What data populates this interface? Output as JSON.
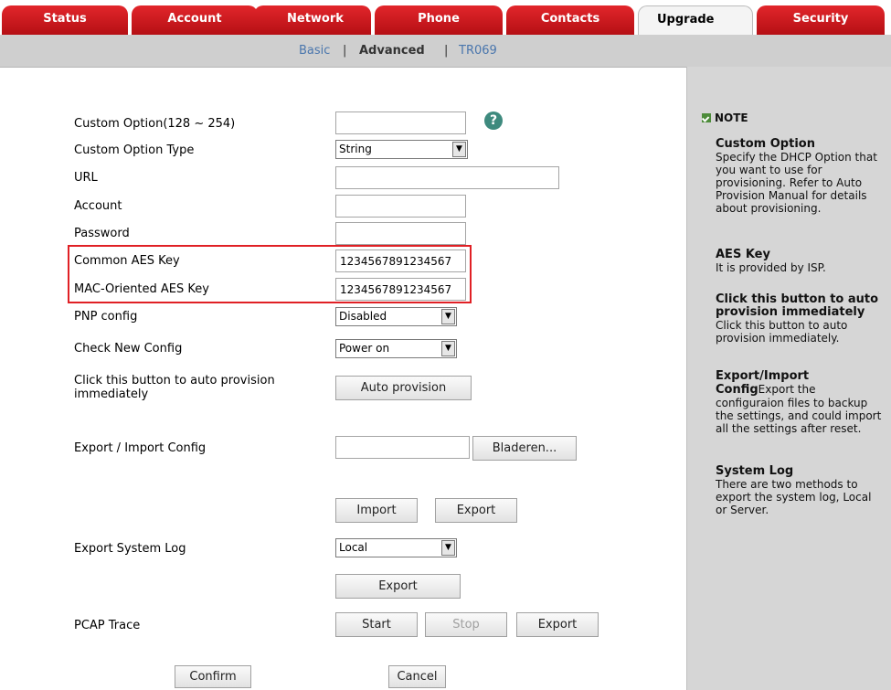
{
  "tabs": [
    {
      "label": "Status"
    },
    {
      "label": "Account"
    },
    {
      "label": "Network"
    },
    {
      "label": "Phone"
    },
    {
      "label": "Contacts"
    },
    {
      "label": "Upgrade",
      "active": true
    },
    {
      "label": "Security"
    }
  ],
  "subnav": {
    "basic": "Basic",
    "advanced": "Advanced",
    "tr069": "TR069",
    "separator": "|"
  },
  "form": {
    "custom_option": {
      "label": "Custom Option(128 ~ 254)",
      "value": ""
    },
    "custom_option_type": {
      "label": "Custom Option Type",
      "value": "String"
    },
    "url": {
      "label": "URL",
      "value": ""
    },
    "account": {
      "label": "Account",
      "value": ""
    },
    "password": {
      "label": "Password",
      "value": ""
    },
    "common_aes_key": {
      "label": "Common AES Key",
      "value": "1234567891234567"
    },
    "mac_aes_key": {
      "label": "MAC-Oriented AES Key",
      "value": "1234567891234567"
    },
    "pnp_config": {
      "label": "PNP config",
      "value": "Disabled"
    },
    "check_new_config": {
      "label": "Check New Config",
      "value": "Power on"
    },
    "auto_provision": {
      "label": "Click this button to auto provision immediately",
      "button": "Auto provision"
    },
    "export_import": {
      "label": "Export / Import Config",
      "value": "",
      "browse": "Bladeren...",
      "import": "Import",
      "export": "Export"
    },
    "system_log": {
      "label": "Export System Log",
      "value": "Local",
      "export": "Export"
    },
    "pcap": {
      "label": "PCAP Trace",
      "start": "Start",
      "stop": "Stop",
      "export": "Export"
    },
    "confirm": "Confirm",
    "cancel": "Cancel",
    "help_glyph": "?"
  },
  "note": {
    "title": "NOTE",
    "sections": [
      {
        "title": "Custom Option",
        "lines": [
          "Specify the DHCP Option that",
          "you want to use for",
          "provisioning. Refer to Auto",
          "Provision Manual for details",
          "about provisioning."
        ]
      },
      {
        "title": "AES Key",
        "lines": [
          "It is provided by ISP."
        ]
      },
      {
        "title_lines": [
          "Click this button to auto",
          "provision immediately"
        ],
        "lines": [
          "Click this button to auto",
          "provision immediately."
        ]
      },
      {
        "title_lines": [
          "Export/Import"
        ],
        "inline_bold": "Config",
        "inline_rest": "Export the",
        "lines": [
          "configuraion files to backup",
          "the settings, and could import",
          "all the settings after reset."
        ]
      },
      {
        "title": "System Log",
        "lines": [
          "There are two methods to",
          "export the system log, Local",
          "or Server."
        ]
      }
    ]
  },
  "colors": {
    "tab_red": "#d11a20",
    "highlight": "#e02025",
    "note_bg": "#d6d6d6",
    "subnav_bg": "#cfcfcf"
  }
}
